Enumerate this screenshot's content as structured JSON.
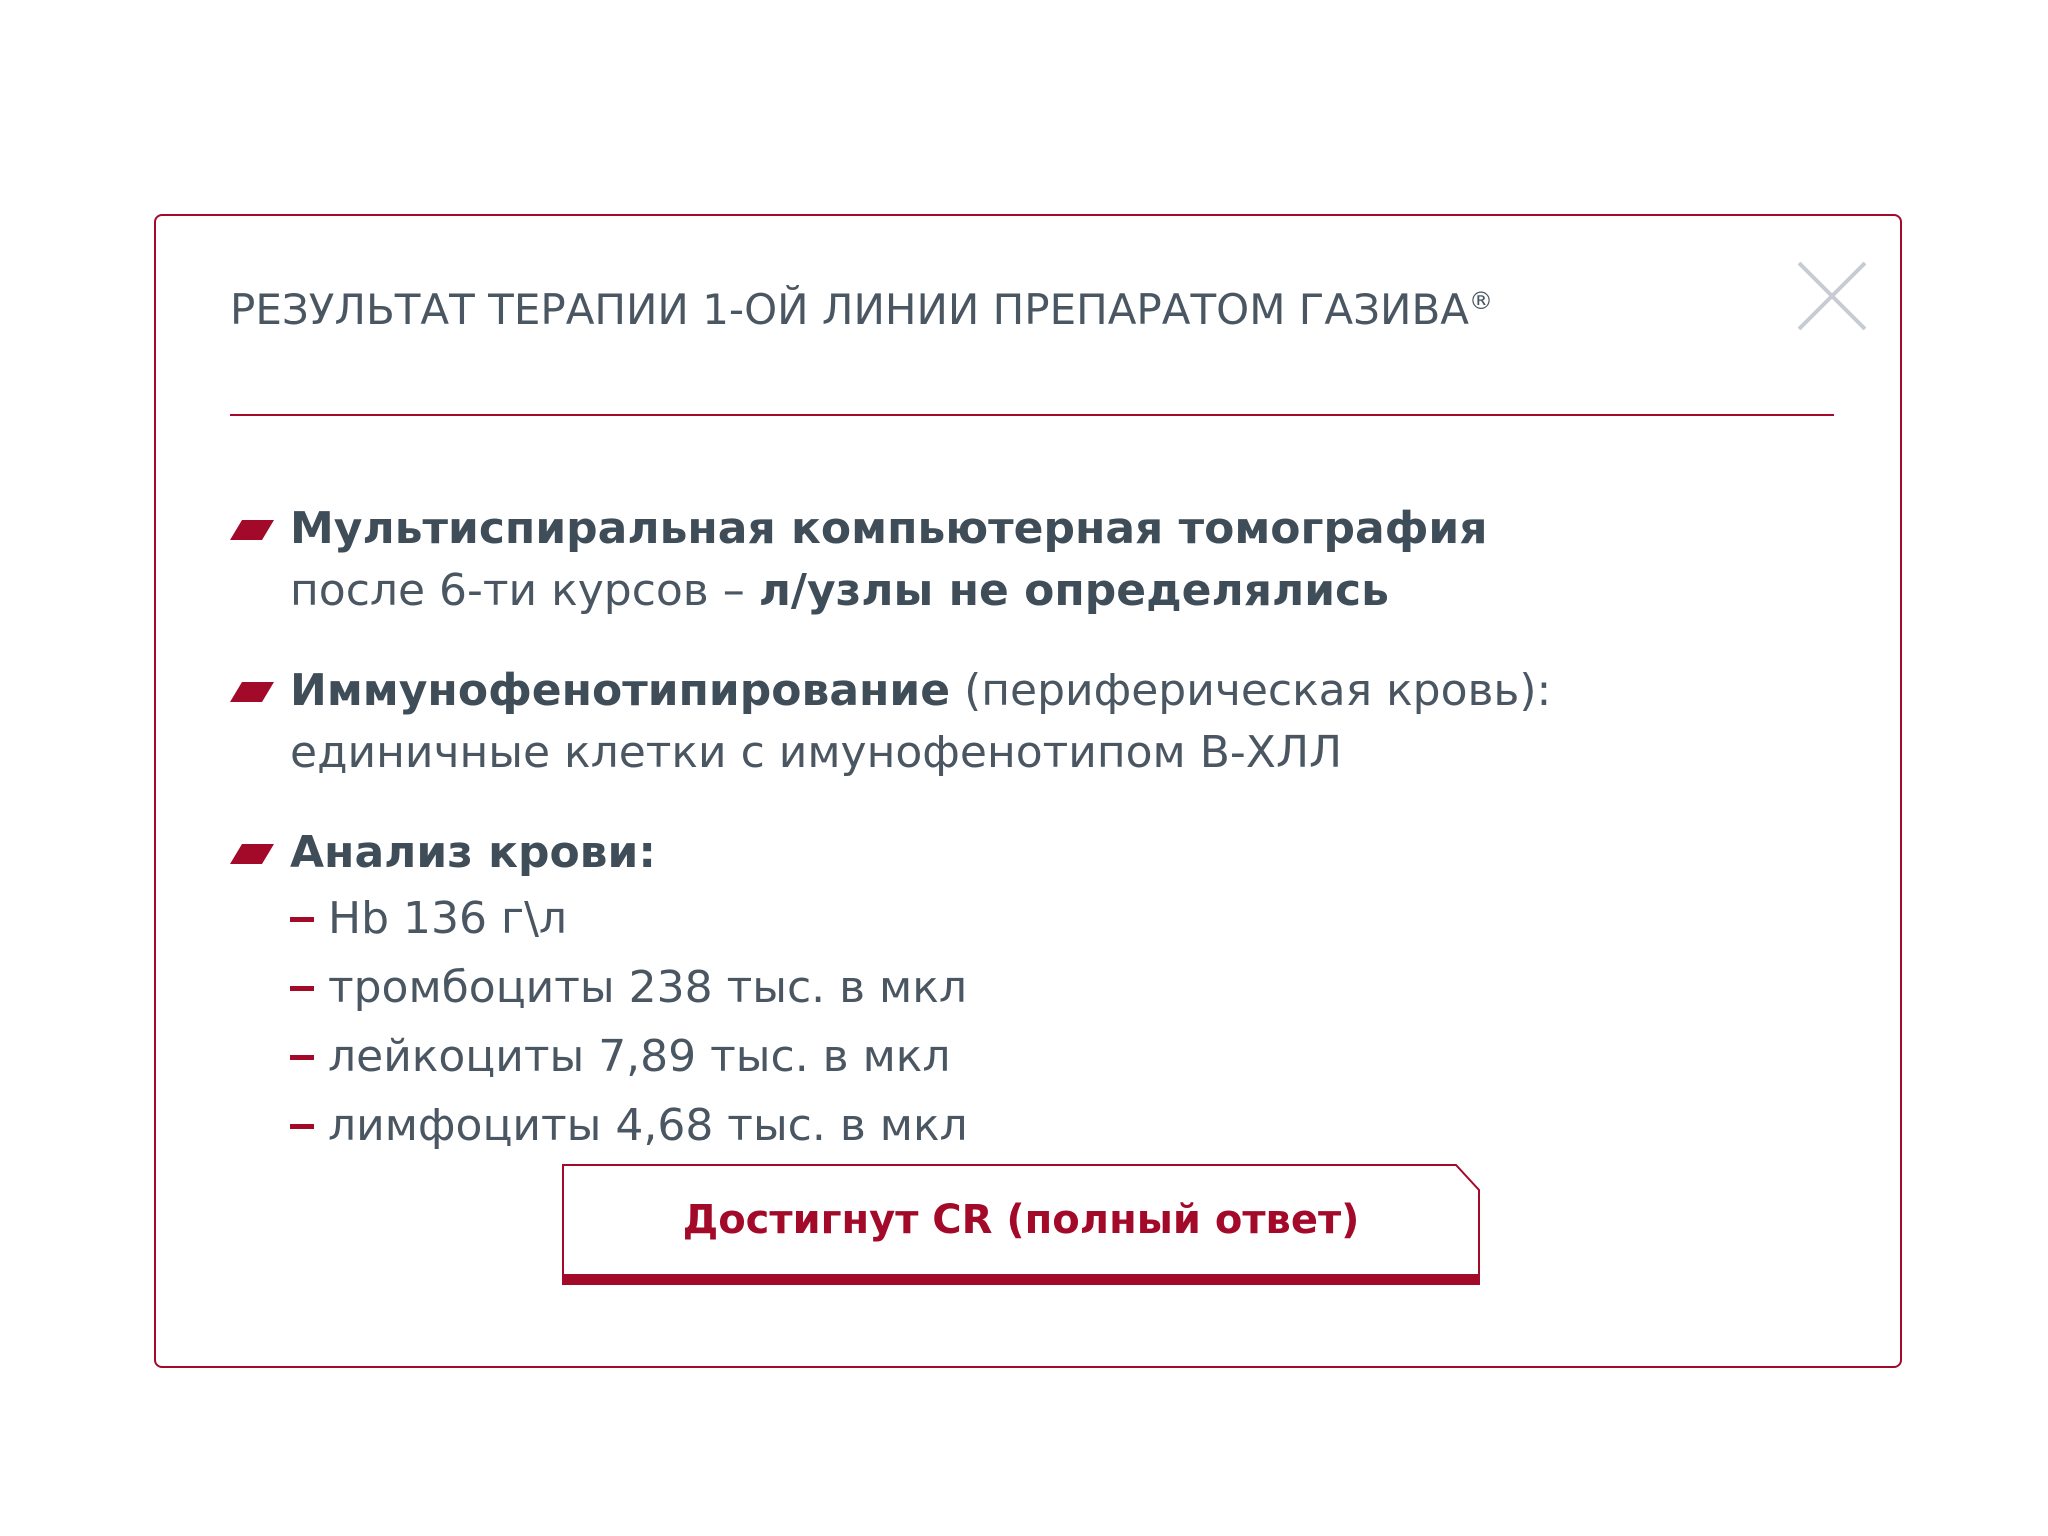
{
  "modal": {
    "title": "РЕЗУЛЬТАТ ТЕРАПИИ 1-ОЙ ЛИНИИ ПРЕПАРАТОМ ГАЗИВА",
    "title_mark": "®",
    "close_icon": "close-icon"
  },
  "colors": {
    "accent": "#a30a2a",
    "text": "#4a5762",
    "close_icon": "#c6ccd1"
  },
  "sections": [
    {
      "line1_bold": "Мультиспиральная компьютерная томография",
      "line2_regular": "после 6-ти курсов – ",
      "line2_bold": "л/узлы не определялись"
    },
    {
      "line1_bold": "Иммунофенотипирование",
      "line1_regular": " (периферическая кровь):",
      "line2_regular": "единичные клетки с имунофенотипом В-ХЛЛ"
    },
    {
      "line1_bold": "Анализ крови:",
      "items": [
        "Hb 136 г\\л",
        "тромбоциты 238 тыс. в мкл",
        "лейкоциты 7,89 тыс. в мкл",
        "лимфоциты 4,68 тыс. в мкл"
      ]
    }
  ],
  "result": {
    "label": "Достигнут CR (полный ответ)"
  }
}
